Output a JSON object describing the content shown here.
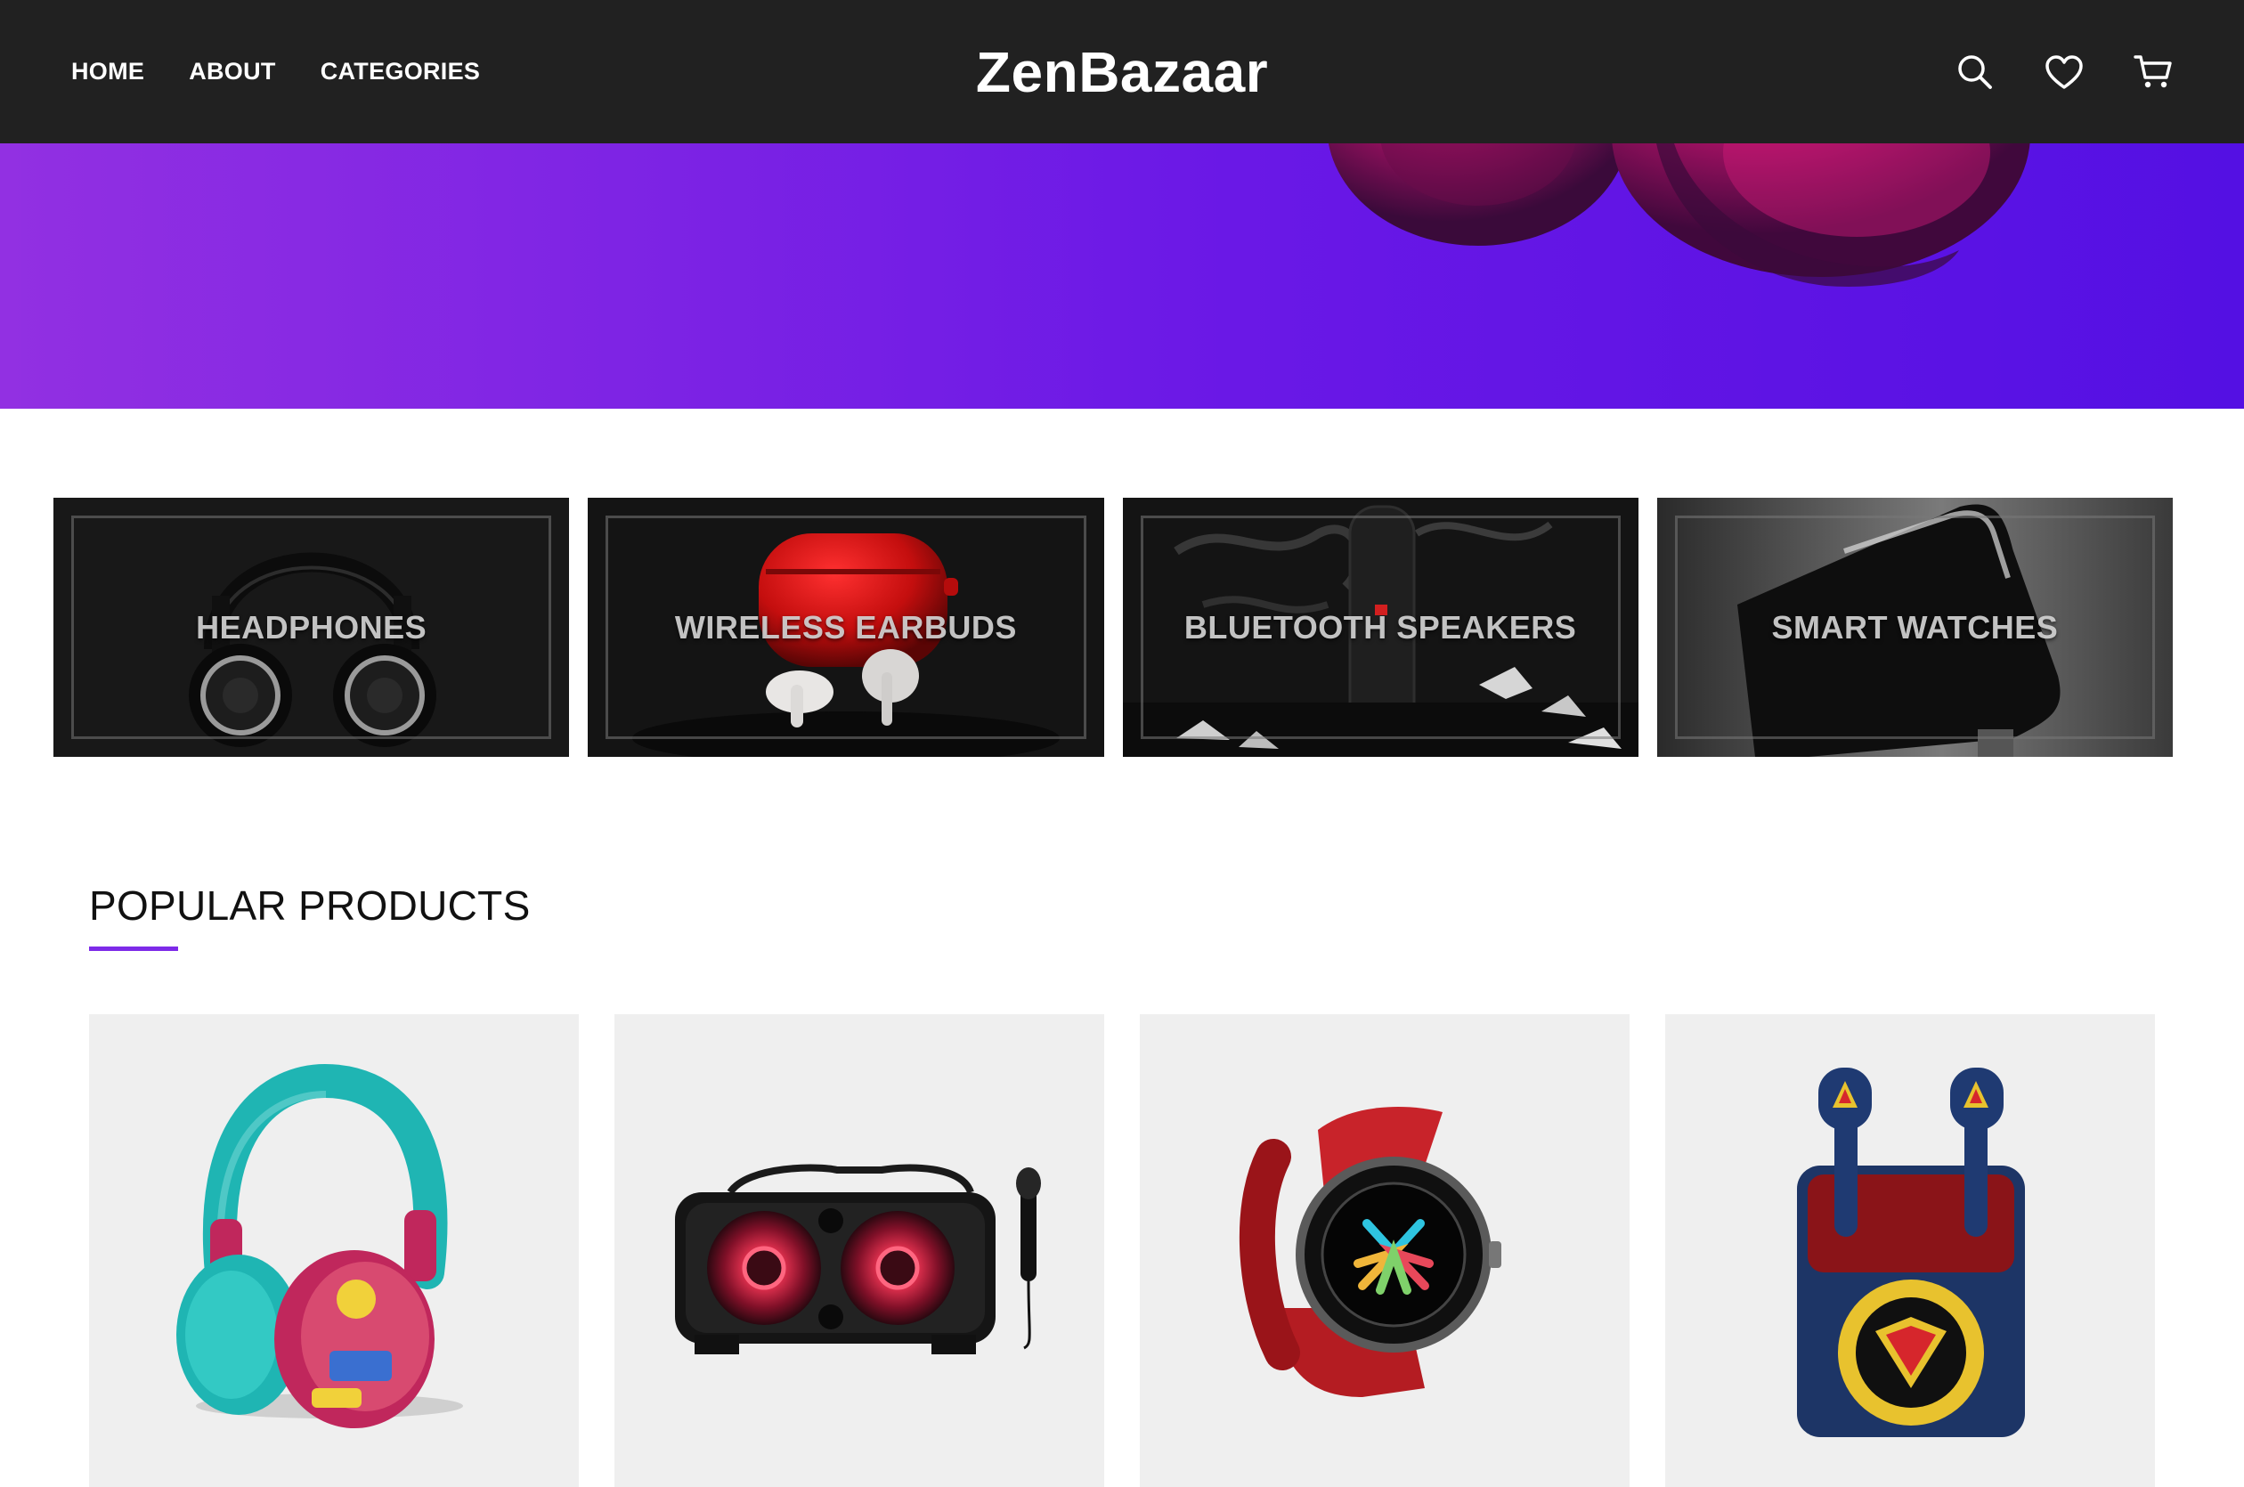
{
  "header": {
    "nav": [
      {
        "label": "HOME"
      },
      {
        "label": "ABOUT"
      },
      {
        "label": "CATEGORIES"
      }
    ],
    "brand": "ZenBazaar",
    "icons": [
      "search-icon",
      "heart-icon",
      "cart-icon"
    ]
  },
  "hero": {
    "gradient_start": "#9230e2",
    "gradient_end": "#5410e3"
  },
  "categories": [
    {
      "label": "HEADPHONES"
    },
    {
      "label": "WIRELESS EARBUDS"
    },
    {
      "label": "BLUETOOTH SPEAKERS"
    },
    {
      "label": "SMART WATCHES"
    }
  ],
  "popular": {
    "title": "POPULAR PRODUCTS",
    "accent": "#7d2ae8",
    "products": [
      {
        "image": "headphones-image"
      },
      {
        "image": "party-speaker-image"
      },
      {
        "image": "smartwatch-image"
      },
      {
        "image": "earbuds-case-image"
      }
    ]
  },
  "colors": {
    "header_bg": "#212121",
    "tile_bg": "#efefef"
  }
}
